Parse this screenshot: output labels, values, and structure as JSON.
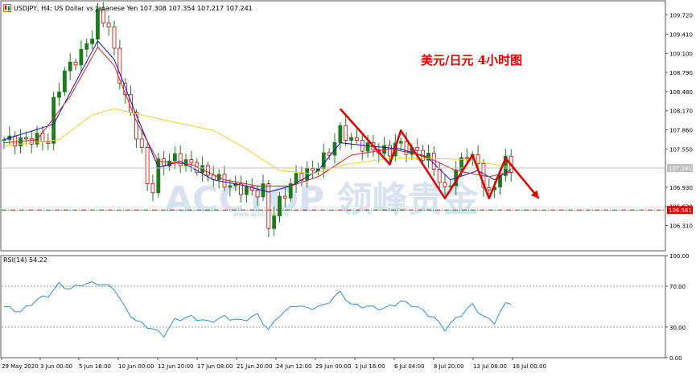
{
  "header": {
    "symbol": "USDJPY, H4:",
    "description": "US Dollar vs Japanese Yen",
    "ohlc": "107.308 107.354 107.217 107.241"
  },
  "annotation": "美元/日元 4小时图",
  "watermark": "ACCTOP 领峰贵金",
  "watermark_url": "www.acetop.com",
  "rsi": {
    "label": "RSI(14) 54.22",
    "value": 54.22,
    "levels": [
      70,
      30
    ]
  },
  "colors": {
    "candle_up": "#1f7a1f",
    "candle_down": "#1f7a1f",
    "ma_fast": "#1010c0",
    "ma_mid": "#e02020",
    "ma_slow": "#f0d030",
    "rsi_line": "#2b90d9",
    "annotation": "#e00000",
    "support": "#e00000"
  },
  "chart_data": [
    {
      "type": "candlestick",
      "title": "USDJPY, H4",
      "y_ticks": [
        "109.720",
        "109.410",
        "109.100",
        "108.790",
        "108.480",
        "108.170",
        "107.860",
        "107.550",
        "107.241",
        "106.930",
        "106.620",
        "106.561",
        "106.310"
      ],
      "ylim": [
        105.9,
        109.95
      ],
      "current_price": 107.241,
      "support_level": 106.561,
      "x_ticks": [
        "29 May 2020",
        "3 Jun 00:00",
        "5 Jun 16:00",
        "10 Jun 00:00",
        "12 Jun 20:00",
        "17 Jun 08:00",
        "21 Jun 20:00",
        "24 Jun 12:00",
        "29 Jun 00:00",
        "1 Jul 16:00",
        "6 Jul 04:00",
        "8 Jul 20:00",
        "13 Jul 08:00",
        "16 Jul 00:00"
      ],
      "close_path": [
        [
          0,
          107.7
        ],
        [
          3,
          107.68
        ],
        [
          6,
          107.72
        ],
        [
          8,
          107.68
        ],
        [
          9,
          108.3
        ],
        [
          11,
          108.8
        ],
        [
          14,
          109.1
        ],
        [
          16,
          109.4
        ],
        [
          17,
          109.72
        ],
        [
          19,
          109.55
        ],
        [
          20,
          109.1
        ],
        [
          21,
          108.7
        ],
        [
          23,
          108.1
        ],
        [
          25,
          107.5
        ],
        [
          26,
          107.0
        ],
        [
          27,
          106.9
        ],
        [
          28,
          107.3
        ],
        [
          31,
          107.4
        ],
        [
          34,
          107.3
        ],
        [
          36,
          107.2
        ],
        [
          38,
          107.1
        ],
        [
          41,
          106.95
        ],
        [
          43,
          106.9
        ],
        [
          46,
          106.85
        ],
        [
          47,
          106.9
        ],
        [
          48,
          106.3
        ],
        [
          50,
          106.7
        ],
        [
          53,
          107.1
        ],
        [
          56,
          107.2
        ],
        [
          58,
          107.4
        ],
        [
          59,
          107.5
        ],
        [
          61,
          107.85
        ],
        [
          63,
          107.7
        ],
        [
          65,
          107.6
        ],
        [
          67,
          107.55
        ],
        [
          70,
          107.5
        ],
        [
          71,
          107.65
        ],
        [
          73,
          107.55
        ],
        [
          75,
          107.5
        ],
        [
          77,
          107.4
        ],
        [
          78,
          107.25
        ],
        [
          80,
          106.85
        ],
        [
          82,
          107.2
        ],
        [
          84,
          107.5
        ],
        [
          86,
          107.3
        ],
        [
          87,
          107.0
        ],
        [
          88,
          106.8
        ],
        [
          90,
          107.15
        ],
        [
          91,
          107.35
        ],
        [
          92,
          107.25
        ]
      ],
      "moving_averages": [
        {
          "name": "MA fast",
          "color": "blue",
          "points": [
            [
              0,
              107.7
            ],
            [
              9,
              107.95
            ],
            [
              14,
              108.8
            ],
            [
              17,
              109.3
            ],
            [
              20,
              109.0
            ],
            [
              24,
              108.1
            ],
            [
              28,
              107.25
            ],
            [
              32,
              107.35
            ],
            [
              38,
              107.05
            ],
            [
              44,
              106.95
            ],
            [
              48,
              106.85
            ],
            [
              52,
              106.95
            ],
            [
              57,
              107.2
            ],
            [
              61,
              107.65
            ],
            [
              66,
              107.6
            ],
            [
              72,
              107.55
            ],
            [
              77,
              107.4
            ],
            [
              81,
              107.05
            ],
            [
              86,
              107.2
            ],
            [
              89,
              107.05
            ],
            [
              92,
              107.22
            ]
          ]
        },
        {
          "name": "MA mid",
          "color": "red",
          "points": [
            [
              0,
              107.65
            ],
            [
              6,
              107.7
            ],
            [
              12,
              108.4
            ],
            [
              17,
              109.2
            ],
            [
              20,
              108.9
            ],
            [
              24,
              108.0
            ],
            [
              28,
              107.35
            ],
            [
              34,
              107.3
            ],
            [
              40,
              107.05
            ],
            [
              46,
              106.95
            ],
            [
              52,
              106.95
            ],
            [
              57,
              107.1
            ],
            [
              63,
              107.45
            ],
            [
              70,
              107.55
            ],
            [
              76,
              107.45
            ],
            [
              82,
              107.2
            ],
            [
              88,
              107.1
            ],
            [
              92,
              107.18
            ]
          ]
        },
        {
          "name": "MA slow",
          "color": "yellow",
          "points": [
            [
              0,
              107.6
            ],
            [
              10,
              107.7
            ],
            [
              16,
              108.1
            ],
            [
              20,
              108.2
            ],
            [
              30,
              108.0
            ],
            [
              38,
              107.85
            ],
            [
              44,
              107.55
            ],
            [
              50,
              107.2
            ],
            [
              56,
              107.15
            ],
            [
              62,
              107.3
            ],
            [
              70,
              107.4
            ],
            [
              76,
              107.4
            ],
            [
              84,
              107.38
            ],
            [
              92,
              107.25
            ]
          ]
        }
      ],
      "zigzag_arrow": [
        [
          61,
          108.2
        ],
        [
          70,
          107.3
        ],
        [
          72,
          107.85
        ],
        [
          80,
          106.75
        ],
        [
          85,
          107.45
        ],
        [
          88,
          106.75
        ],
        [
          91,
          107.4
        ],
        [
          97,
          106.75
        ]
      ]
    },
    {
      "type": "line",
      "title": "RSI(14)",
      "y_ticks": [
        "100.00",
        "70.00",
        "30.00",
        "0.00"
      ],
      "ylim": [
        0,
        100
      ],
      "levels": [
        70,
        30
      ],
      "values": [
        [
          0,
          50
        ],
        [
          3,
          45
        ],
        [
          6,
          57
        ],
        [
          8,
          61
        ],
        [
          10,
          72
        ],
        [
          12,
          67
        ],
        [
          14,
          72
        ],
        [
          17,
          73
        ],
        [
          20,
          68
        ],
        [
          22,
          48
        ],
        [
          24,
          36
        ],
        [
          27,
          28
        ],
        [
          29,
          22
        ],
        [
          31,
          37
        ],
        [
          34,
          40
        ],
        [
          37,
          35
        ],
        [
          40,
          40
        ],
        [
          43,
          36
        ],
        [
          46,
          42
        ],
        [
          48,
          27
        ],
        [
          50,
          42
        ],
        [
          53,
          52
        ],
        [
          55,
          48
        ],
        [
          58,
          51
        ],
        [
          61,
          64
        ],
        [
          63,
          52
        ],
        [
          66,
          50
        ],
        [
          69,
          48
        ],
        [
          72,
          55
        ],
        [
          74,
          52
        ],
        [
          76,
          46
        ],
        [
          78,
          39
        ],
        [
          80,
          28
        ],
        [
          82,
          38
        ],
        [
          85,
          52
        ],
        [
          87,
          40
        ],
        [
          89,
          35
        ],
        [
          91,
          53
        ],
        [
          92,
          54.2
        ]
      ]
    }
  ]
}
